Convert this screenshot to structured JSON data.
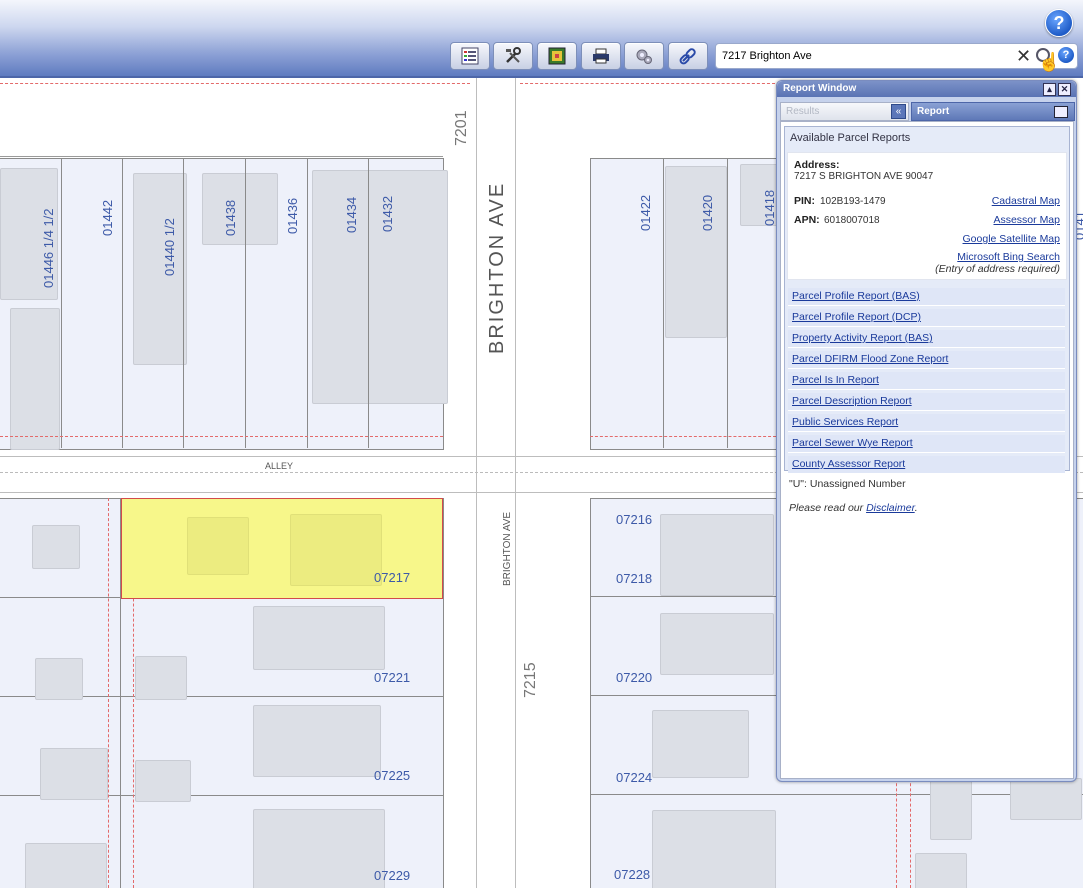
{
  "header": {
    "help_label": "?",
    "toolbar": [
      {
        "name": "legend-button",
        "icon": "list-icon"
      },
      {
        "name": "tools-button",
        "icon": "tools-icon"
      },
      {
        "name": "layers-button",
        "icon": "map-layers-icon"
      },
      {
        "name": "print-button",
        "icon": "printer-icon"
      },
      {
        "name": "settings-button",
        "icon": "gears-icon"
      },
      {
        "name": "link-button",
        "icon": "link-icon"
      }
    ],
    "search": {
      "value": "7217 Brighton Ave",
      "clear": "✕",
      "help": "?"
    }
  },
  "map": {
    "street_main": "BRIGHTON AVE",
    "street_small": "BRIGHTON AVE",
    "alley": "ALLEY",
    "addr_top": "7201",
    "addr_mid": "7215",
    "top_left_lots": [
      "01446 1/4 1/2",
      "01442",
      "01440 1/2",
      "01438",
      "01436",
      "01434",
      "01432"
    ],
    "top_right_lots": [
      "01422",
      "01420",
      "01418",
      "0141"
    ],
    "left_lots": [
      "07217",
      "07221",
      "07225",
      "07229"
    ],
    "right_lots": [
      "07216",
      "07218",
      "07220",
      "07224",
      "07228"
    ]
  },
  "report": {
    "title": "Report Window",
    "tab_results": "Results",
    "tab_collapse": "«",
    "tab_report": "Report",
    "available_heading": "Available Parcel Reports",
    "address_label": "Address:",
    "address_value": "7217 S BRIGHTON AVE 90047",
    "pin_label": "PIN:",
    "pin_value": "102B193-1479",
    "apn_label": "APN:",
    "apn_value": "6018007018",
    "links": {
      "cadastral": "Cadastral Map",
      "assessor": "Assessor Map",
      "google": "Google Satellite Map",
      "bing": "Microsoft Bing Search",
      "bing_note": "(Entry of address required)"
    },
    "reports": [
      "Parcel Profile Report (BAS)",
      "Parcel Profile Report (DCP)",
      "Property Activity Report (BAS)",
      "Parcel DFIRM Flood Zone Report",
      "Parcel Is In Report",
      "Parcel Description Report",
      "Public Services Report",
      "Parcel Sewer Wye Report",
      "County Assessor Report"
    ],
    "unassigned": "\"U\": Unassigned Number",
    "disclaimer_prefix": "Please read our ",
    "disclaimer_link": "Disclaimer",
    "disclaimer_suffix": "."
  }
}
